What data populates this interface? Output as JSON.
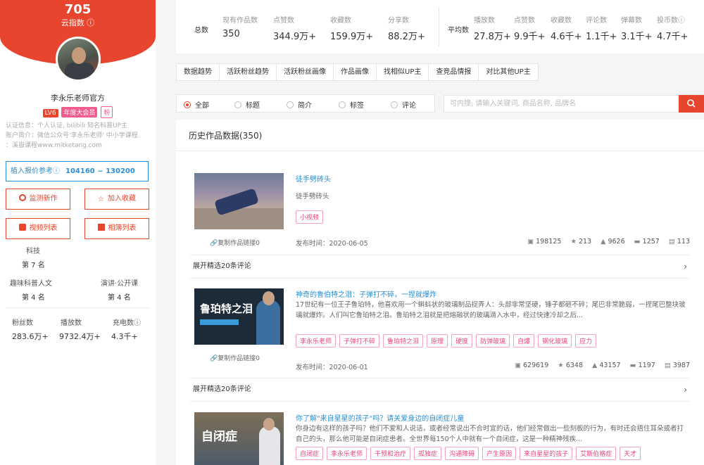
{
  "profile": {
    "cloud_index_value": "705",
    "cloud_index_label": "云指数",
    "name": "李永乐老师官方",
    "badges": [
      "LV6",
      "年度大会员",
      "粉"
    ],
    "meta_lines": [
      "认证信息：个人认证, bilibili 知名科普UP主",
      "账户简介：微信公众号'李永乐老师' 中小学课程",
      "：溪嶽课程www.mitketang.com"
    ],
    "quote_label": "植入报价参考",
    "quote_range": "104160 ~ 130200",
    "buttons": {
      "monitor": "监测新作",
      "favorite": "加入收藏",
      "video_list": "视频列表",
      "album_list": "相簿列表"
    },
    "rank": [
      {
        "label": "科技",
        "value": "第 7 名"
      },
      {
        "label": "趣味科普人文",
        "value": "第 4 名"
      },
      {
        "label": "演讲·公开课",
        "value": "第 4 名"
      }
    ],
    "totals": [
      {
        "label": "粉丝数",
        "value": "283.6万+"
      },
      {
        "label": "播放数",
        "value": "9732.4万+"
      },
      {
        "label": "充电数",
        "value": "4.3千+"
      }
    ]
  },
  "summary": {
    "total_label": "总数",
    "avg_label": "平均数",
    "total_cols": [
      {
        "label": "现有作品数",
        "value": "350"
      },
      {
        "label": "点赞数",
        "value": "344.9万+"
      },
      {
        "label": "收藏数",
        "value": "159.9万+"
      },
      {
        "label": "分享数",
        "value": "88.2万+"
      }
    ],
    "avg_cols": [
      {
        "label": "播放数",
        "value": "27.8万+"
      },
      {
        "label": "点赞数",
        "value": "9.9千+"
      },
      {
        "label": "收藏数",
        "value": "4.6千+"
      },
      {
        "label": "评论数",
        "value": "1.1千+"
      },
      {
        "label": "弹幕数",
        "value": "3.1千+"
      },
      {
        "label": "投币数",
        "value": "4.7千+"
      }
    ]
  },
  "tabs": [
    "数据趋势",
    "活跃粉丝趋势",
    "活跃粉丝画像",
    "作品画像",
    "找相似UP主",
    "查竞品情报",
    "对比其他UP主"
  ],
  "filter": {
    "options": [
      "全部",
      "标题",
      "简介",
      "标签",
      "评论"
    ],
    "selected": "全部",
    "search_placeholder": "可内搜, 请输入关键词, 商品名称, 品牌名"
  },
  "history": {
    "title": "历史作品数据(350)",
    "copy_label": "复制作品链接",
    "pub_prefix": "发布时间：",
    "expand_label": "展开精选20条评论",
    "items": [
      {
        "title": "徒手劈砖头",
        "desc": "徒手劈砖头",
        "tags": [
          "小视频"
        ],
        "date": "2020-06-05",
        "play": "198125",
        "coin": "213",
        "like": "9626",
        "comment": "1257",
        "share": "113",
        "copy_count": "0"
      },
      {
        "title": "神奇的鲁伯特之泪：子弹打不碎，一捏就爆炸",
        "desc": "17世纪有一位王子鲁珀特，他喜欢用一个蝌蚪状的玻璃制品捉弄人：头部非常坚硬，锤子都砸不碎；尾巴非常脆弱，一捏尾巴整块玻璃就爆炸。人们叫它鲁珀特之泪。鲁珀特之泪就是把熔融状的玻璃滴入水中，经过快速冷却之后...",
        "tags": [
          "李永乐老师",
          "子弹打不碎",
          "鲁珀特之泪",
          "原理",
          "硬度",
          "防弹玻璃",
          "自爆",
          "钢化玻璃",
          "应力"
        ],
        "date": "2020-06-01",
        "play": "629619",
        "coin": "6348",
        "like": "43157",
        "comment": "1197",
        "share": "3987",
        "copy_count": "0",
        "thumb_text": "鲁珀特之泪"
      },
      {
        "title": "你了解\"来自星星的孩子\"吗？请关爱身边的自闭症儿童",
        "desc": "你身边有这样的孩子吗？他们不爱和人说话，或者经常说出不合时宜的话，他们经常做出一些刻板的行为，有时还会捂住耳朵或者打自己的头，那么他可能是自闭症患者。全世界每150个人中就有一个自闭症，这是一种精神残疾...",
        "tags": [
          "自闭症",
          "李永乐老师",
          "干预和治疗",
          "孤独症",
          "沟通障碍",
          "产生原因",
          "来自星星的孩子",
          "艾斯伯格症",
          "天才"
        ],
        "thumb_text": "自闭症"
      }
    ]
  }
}
